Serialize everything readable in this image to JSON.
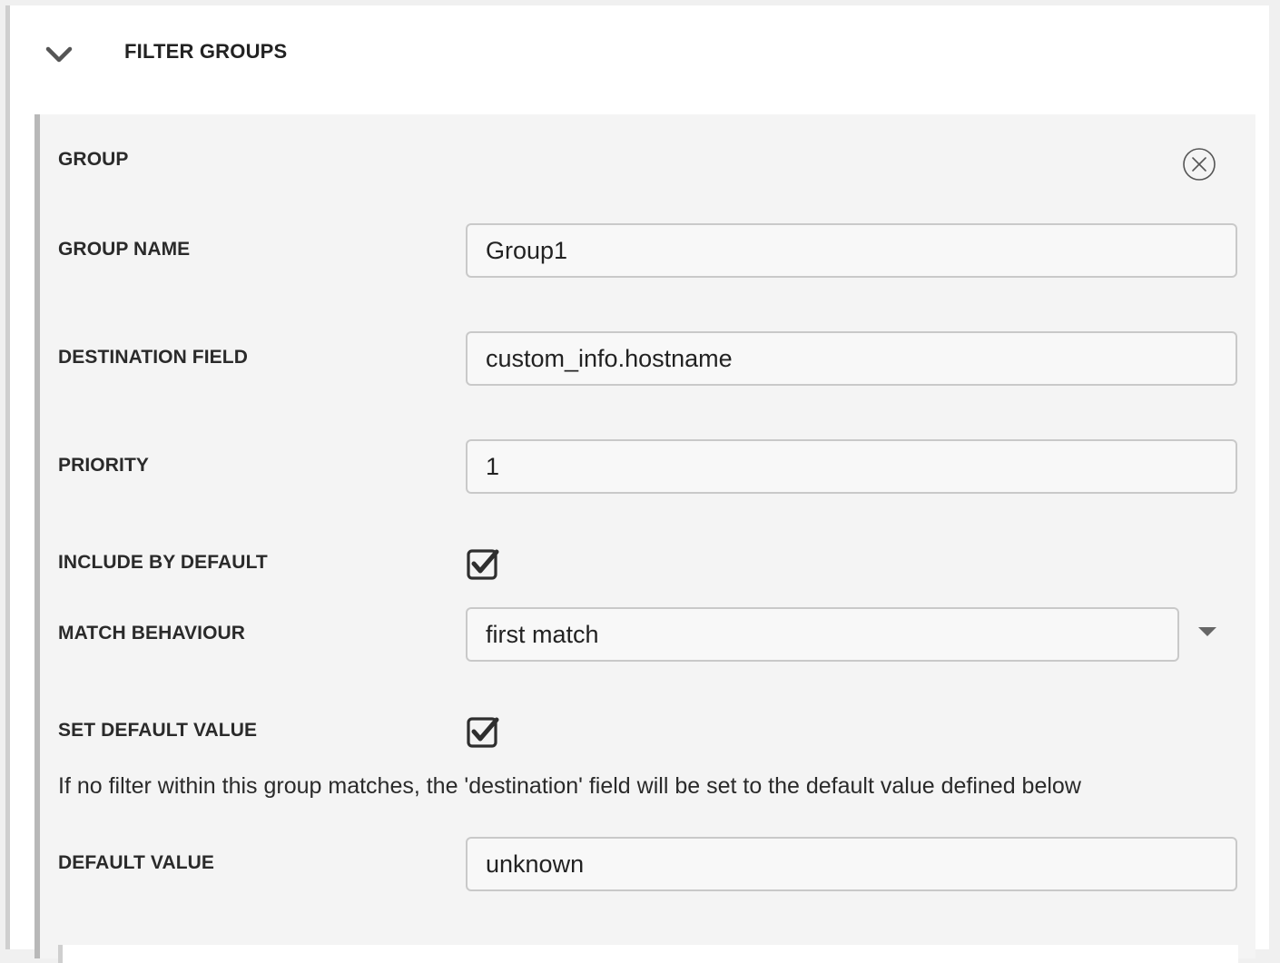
{
  "section": {
    "title": "FILTER GROUPS",
    "chevron_icon": "chevron-down-icon"
  },
  "group": {
    "title": "GROUP",
    "close_icon": "close-circle-icon",
    "fields": {
      "group_name": {
        "label": "GROUP NAME",
        "value": "Group1"
      },
      "destination_field": {
        "label": "DESTINATION FIELD",
        "value": "custom_info.hostname"
      },
      "priority": {
        "label": "PRIORITY",
        "value": "1"
      },
      "include_by_default": {
        "label": "INCLUDE BY DEFAULT",
        "checked": true
      },
      "match_behaviour": {
        "label": "MATCH BEHAVIOUR",
        "value": "first match"
      },
      "set_default_value": {
        "label": "SET DEFAULT VALUE",
        "checked": true
      },
      "help_text": "If no filter within this group matches, the 'destination' field will be set to the default value defined below",
      "default_value": {
        "label": "DEFAULT VALUE",
        "value": "unknown"
      }
    }
  },
  "colors": {
    "panel_background": "#f4f4f4",
    "outer_background": "#ffffff",
    "border_accent": "#b8b8b8",
    "input_border": "#c9c9c9",
    "text": "#222222"
  }
}
